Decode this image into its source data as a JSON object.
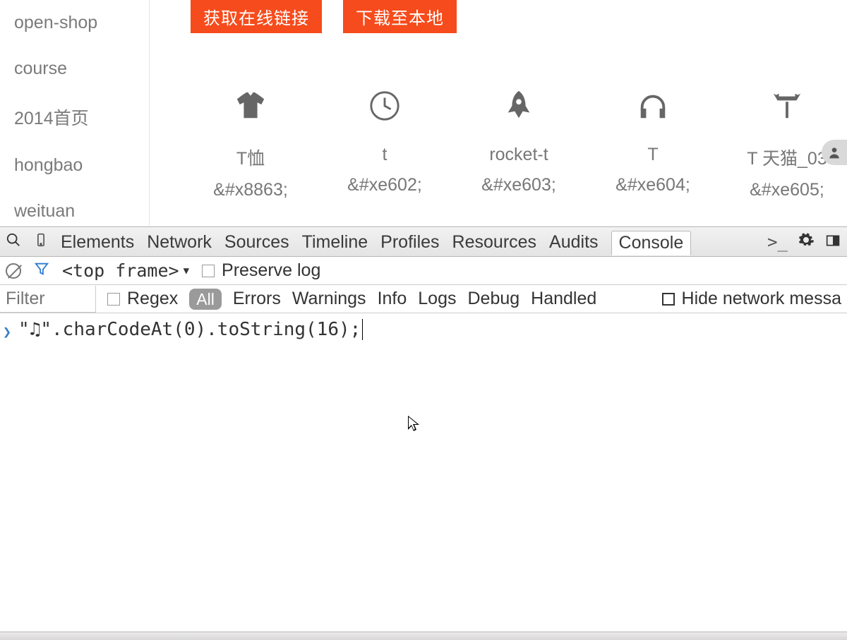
{
  "sidebar": {
    "items": [
      {
        "label": "open-shop"
      },
      {
        "label": "course"
      },
      {
        "label": "2014首页"
      },
      {
        "label": "hongbao"
      },
      {
        "label": "weituan"
      }
    ]
  },
  "buttons": {
    "get_link": "获取在线链接",
    "download": "下载至本地"
  },
  "icons": [
    {
      "name": "T恤",
      "code": "&#x8863;"
    },
    {
      "name": "t",
      "code": "&#xe602;"
    },
    {
      "name": "rocket-t",
      "code": "&#xe603;"
    },
    {
      "name": "T",
      "code": "&#xe604;"
    },
    {
      "name": "T 天猫_03",
      "code": "&#xe605;"
    }
  ],
  "devtools": {
    "tabs": [
      "Elements",
      "Network",
      "Sources",
      "Timeline",
      "Profiles",
      "Resources",
      "Audits",
      "Console"
    ],
    "active_tab": "Console",
    "toolbar": {
      "frame": "<top frame>",
      "preserve_log": "Preserve log"
    },
    "filterbar": {
      "filter_placeholder": "Filter",
      "regex": "Regex",
      "all": "All",
      "levels": [
        "Errors",
        "Warnings",
        "Info",
        "Logs",
        "Debug",
        "Handled"
      ],
      "hide_net": "Hide network messa"
    },
    "console_input": "\"♫\".charCodeAt(0).toString(16);"
  },
  "colors": {
    "orange": "#f64b1c",
    "icon": "#666666"
  }
}
